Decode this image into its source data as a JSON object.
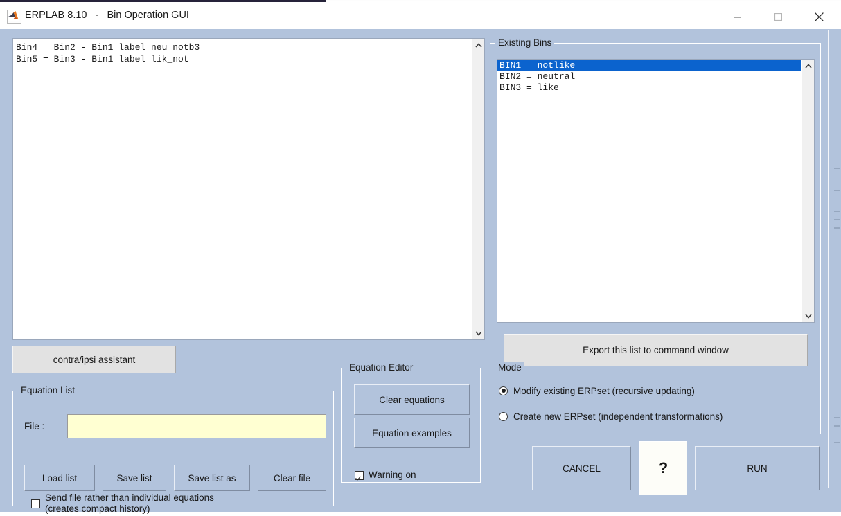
{
  "window": {
    "title": "ERPLAB 8.10   -   Bin Operation GUI",
    "icon": "matlab-icon",
    "minimize_icon": "minimize-icon",
    "maximize_icon": "maximize-icon",
    "close_icon": "close-icon",
    "background_color": "#b2c3dc"
  },
  "equation_editor_area": {
    "equations_text": "Bin4 = Bin2 - Bin1 label neu_notb3\nBin5 = Bin3 - Bin1 label lik_not",
    "scroll_up_icon": "chevron-up-icon",
    "scroll_down_icon": "chevron-down-icon"
  },
  "contra_ipsi": {
    "label": "contra/ipsi assistant"
  },
  "existing_bins": {
    "title": "Existing Bins",
    "items": [
      {
        "label": "BIN1 = notlike",
        "selected": true
      },
      {
        "label": "BIN2 = neutral",
        "selected": false
      },
      {
        "label": "BIN3 = like",
        "selected": false
      }
    ],
    "selection_color": "#0b63ce",
    "export_label": "Export this list to command window",
    "scroll_up_icon": "chevron-up-icon",
    "scroll_down_icon": "chevron-down-icon"
  },
  "equation_list": {
    "title": "Equation List",
    "file_label": "File :",
    "file_value": "",
    "file_placeholder": "",
    "file_field_color": "#ffffd2",
    "buttons": [
      {
        "label": "Load list"
      },
      {
        "label": "Save list"
      },
      {
        "label": "Save list as"
      },
      {
        "label": "Clear file"
      }
    ],
    "send_file_checkbox": {
      "label": "Send file rather than individual equations\n(creates compact history)",
      "checked": false
    }
  },
  "equation_editor": {
    "title": "Equation Editor",
    "clear_label": "Clear equations",
    "examples_label": "Equation examples"
  },
  "warning": {
    "label": "Warning on",
    "checked": true
  },
  "mode": {
    "title": "Mode",
    "options": [
      {
        "label": "Modify existing ERPset (recursive updating)",
        "selected": true
      },
      {
        "label": "Create new ERPset (independent transformations)",
        "selected": false
      }
    ]
  },
  "actions": {
    "cancel_label": "CANCEL",
    "help_label": "?",
    "run_label": "RUN"
  }
}
